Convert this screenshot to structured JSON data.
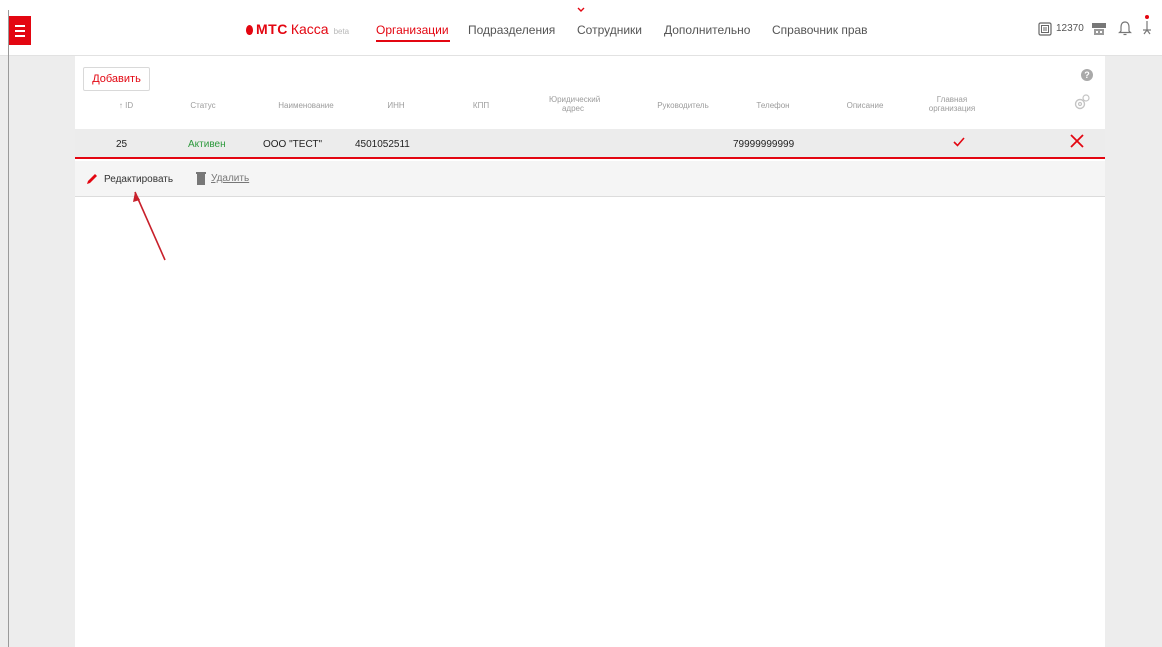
{
  "header": {
    "logo_brand": "МТС",
    "logo_product": "Касса",
    "logo_badge": "beta",
    "nav": [
      {
        "label": "Организации",
        "active": true
      },
      {
        "label": "Подразделения",
        "active": false
      },
      {
        "label": "Сотрудники",
        "active": false
      },
      {
        "label": "Дополнительно",
        "active": false
      },
      {
        "label": "Справочник прав",
        "active": false
      }
    ],
    "balance": "12370"
  },
  "toolbar": {
    "add_label": "Добавить"
  },
  "table": {
    "columns": [
      "↑ ID",
      "Статус",
      "Наименование",
      "ИНН",
      "КПП",
      "Юридический адрес",
      "Руководитель",
      "Телефон",
      "Описание",
      "Главная организация"
    ],
    "rows": [
      {
        "id": "25",
        "status": "Активен",
        "name": "ООО \"ТЕСТ\"",
        "inn": "4501052511",
        "kpp": "",
        "address": "",
        "director": "",
        "phone": "79999999999",
        "description": "",
        "main_org": true
      }
    ]
  },
  "row_actions": {
    "edit_label": "Редактировать",
    "delete_label": "Удалить"
  },
  "colors": {
    "brand": "#e30611",
    "status_active": "#2e9a3e"
  },
  "icons": [
    "menu-icon",
    "chevron-down-icon",
    "calculator-icon",
    "cash-register-icon",
    "bell-icon",
    "user-icon",
    "help-icon",
    "settings-gear-icon",
    "check-icon",
    "delete-x-icon",
    "pencil-icon",
    "trash-icon"
  ]
}
